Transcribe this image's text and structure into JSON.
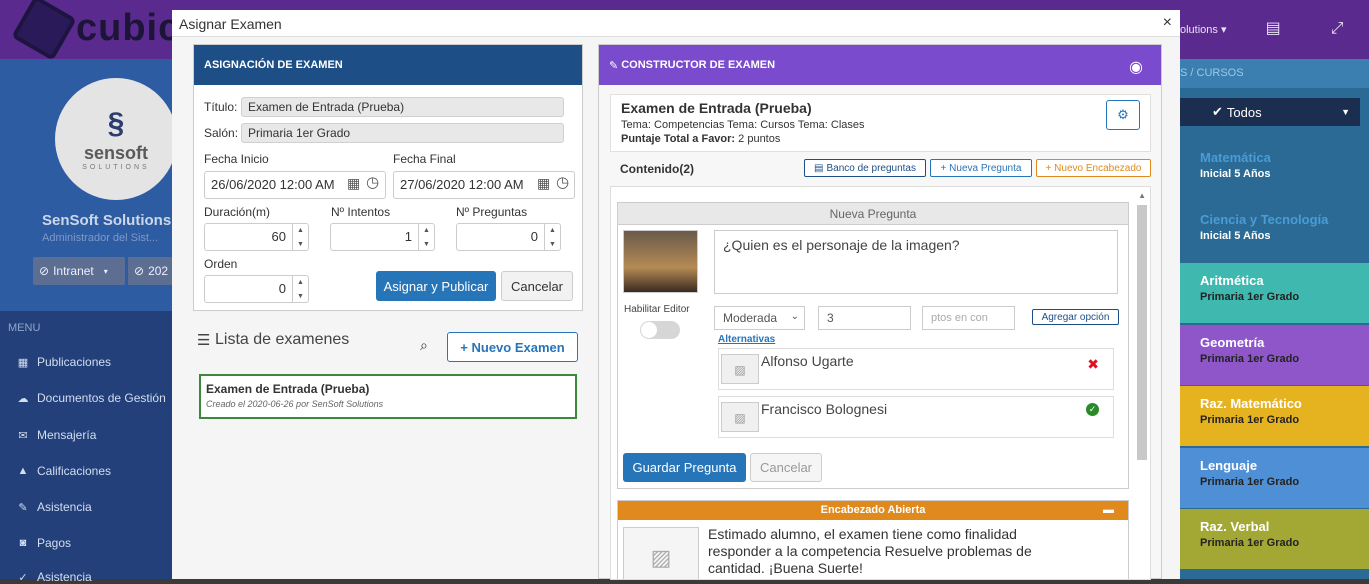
{
  "app": {
    "logo": "cubic",
    "topbar_user": "olutions",
    "user": "SenSoft Solutions",
    "role": "Administrador del Sist...",
    "intranet": "Intranet",
    "year": "202",
    "avatar_main": "sensoft",
    "avatar_sub": "SOLUTIONS"
  },
  "menu": {
    "title": "MENU",
    "items": [
      "Publicaciones",
      "Documentos de Gestión",
      "Mensajería",
      "Calificaciones",
      "Asistencia",
      "Pagos",
      "Asistencia"
    ]
  },
  "right": {
    "head": "S / CURSOS",
    "todos": "Todos",
    "courses": [
      {
        "t": "Matemática",
        "l": "Inicial 5 Años",
        "c": "#4a9cd6"
      },
      {
        "t": "Ciencia y Tecnología",
        "l": "Inicial 5 Años",
        "c": "#4a9cd6"
      },
      {
        "t": "Aritmética",
        "l": "Primaria 1er Grado",
        "c": "#3fb8b0"
      },
      {
        "t": "Geometría",
        "l": "Primaria 1er Grado",
        "c": "#8e56c9"
      },
      {
        "t": "Raz. Matemático",
        "l": "Primaria 1er Grado",
        "c": "#e6b320"
      },
      {
        "t": "Lenguaje",
        "l": "Primaria 1er Grado",
        "c": "#4f8fd6"
      },
      {
        "t": "Raz. Verbal",
        "l": "Primaria 1er Grado",
        "c": "#a2a833"
      }
    ]
  },
  "modal": {
    "title": "Asignar Examen",
    "close": "×"
  },
  "asig": {
    "head": "ASIGNACIÓN DE EXAMEN",
    "titulo_lbl": "Título:",
    "titulo": "Examen de Entrada (Prueba)",
    "salon_lbl": "Salón:",
    "salon": "Primaria 1er Grado",
    "fi_lbl": "Fecha Inicio",
    "fi": "26/06/2020 12:00 AM",
    "ff_lbl": "Fecha Final",
    "ff": "27/06/2020 12:00 AM",
    "dur_lbl": "Duración(m)",
    "dur": "60",
    "int_lbl": "Nº Intentos",
    "int": "1",
    "preg_lbl": "Nº Preguntas",
    "preg": "0",
    "orden_lbl": "Orden",
    "orden": "0",
    "publicar": "Asignar y Publicar",
    "cancelar": "Cancelar"
  },
  "lista": {
    "title": "Lista de examenes",
    "nuevo": "+ Nuevo Examen",
    "item_title": "Examen de Entrada (Prueba)",
    "item_sub": "Creado el 2020-06-26 por SenSoft Solutions"
  },
  "cons": {
    "head": "CONSTRUCTOR DE EXAMEN",
    "exam": "Examen de Entrada (Prueba)",
    "tema": "Tema: Competencias Tema: Cursos Tema: Clases",
    "puntaje_lbl": "Puntaje Total a Favor:",
    "puntaje": "2 puntos",
    "contenido": "Contenido(2)",
    "banco": "Banco de preguntas",
    "nueva_preg": "+ Nueva Pregunta",
    "nuevo_enc": "+ Nuevo Encabezado",
    "np_head": "Nueva Pregunta",
    "pregunta": "¿Quien es el personaje de la imagen?",
    "habilitar": "Habilitar Editor",
    "dificultad": "Moderada",
    "puntos": "3",
    "ptos_ph": "ptos en con",
    "agregar": "Agregar opción",
    "alternativas": "Alternativas",
    "alt1": "Alfonso Ugarte",
    "alt2": "Francisco Bolognesi",
    "guardar": "Guardar Pregunta",
    "cancelar": "Cancelar",
    "enc_head": "Encabezado Abierta",
    "enc_text": "Estimado alumno, el examen tiene como finalidad responder a la competencia Resuelve problemas de cantidad. ¡Buena Suerte!"
  }
}
